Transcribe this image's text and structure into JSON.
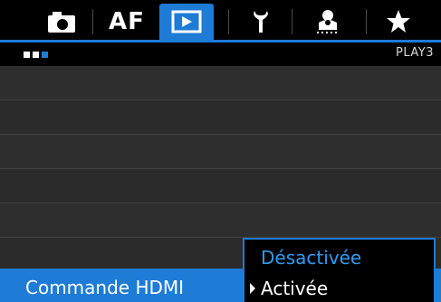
{
  "header": {
    "tabs": [
      {
        "name": "camera-icon",
        "label": ""
      },
      {
        "name": "af-tab",
        "label": "AF"
      },
      {
        "name": "playback-icon",
        "label": ""
      },
      {
        "name": "wrench-icon",
        "label": ""
      },
      {
        "name": "custom-person-icon",
        "label": ""
      },
      {
        "name": "star-icon",
        "label": ""
      }
    ],
    "active_tab": "playback",
    "page_name": "PLAY3",
    "pages_total": 3,
    "current_page": 3
  },
  "menu": {
    "selected_item": "Commande HDMI",
    "options": [
      "Désactivée",
      "Activée"
    ],
    "highlighted_option": "Désactivée",
    "current_value": "Activée"
  },
  "colors": {
    "accent": "#1e7bd6",
    "highlight_text": "#2e9cf0"
  }
}
